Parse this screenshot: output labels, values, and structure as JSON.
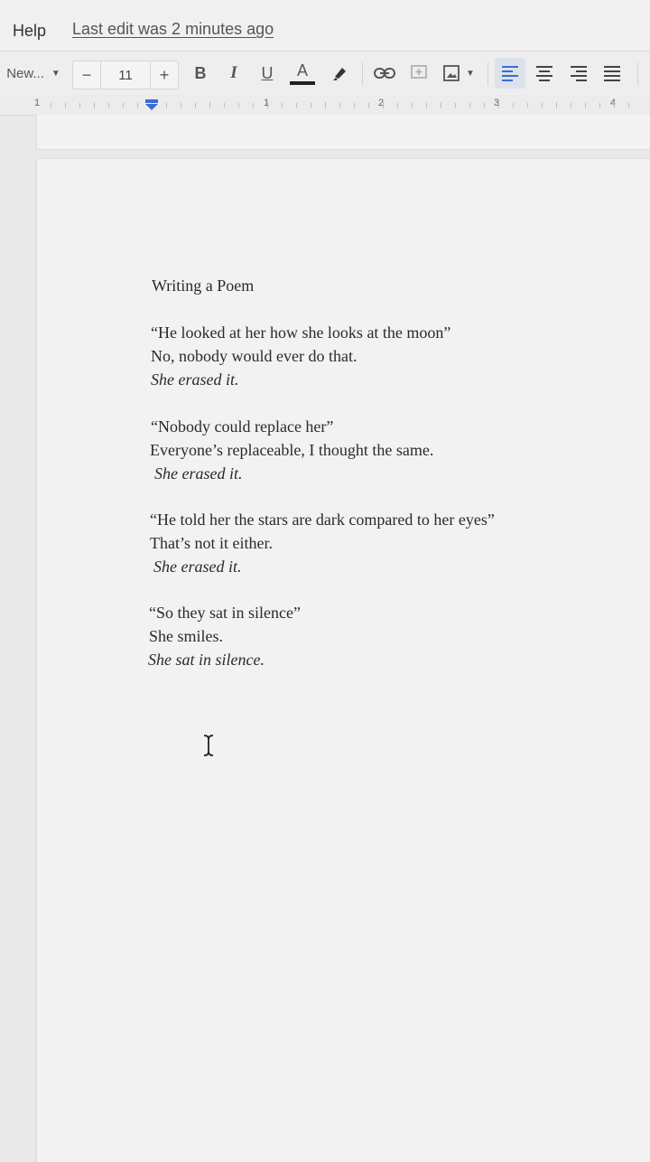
{
  "menu": {
    "help": "Help",
    "last_edit": "Last edit was 2 minutes ago"
  },
  "toolbar": {
    "font_name": "New...",
    "font_size": "11",
    "minus": "−",
    "plus": "+",
    "bold": "B",
    "italic": "I",
    "underline": "U",
    "text_color": "A",
    "icons": [
      "caret-down-icon",
      "highlighter-icon",
      "link-icon",
      "add-comment-icon",
      "image-icon",
      "align-left-icon",
      "align-center-icon",
      "align-right-icon",
      "align-justify-icon"
    ]
  },
  "ruler": {
    "numbers": [
      "1",
      "1",
      "2",
      "3",
      "4"
    ]
  },
  "document": {
    "title": "Writing a Poem",
    "lines": [
      "“He looked at her how she looks at the moon”",
      "No, nobody would ever do that.",
      "She erased it.",
      "“Nobody could replace her”",
      "Everyone’s replaceable, I thought the same.",
      "She erased it.",
      "“He told her the stars are dark compared to her eyes”",
      "That’s not it either.",
      "She erased it.",
      "“So they sat in silence”",
      "She smiles.",
      "She sat in silence."
    ]
  }
}
